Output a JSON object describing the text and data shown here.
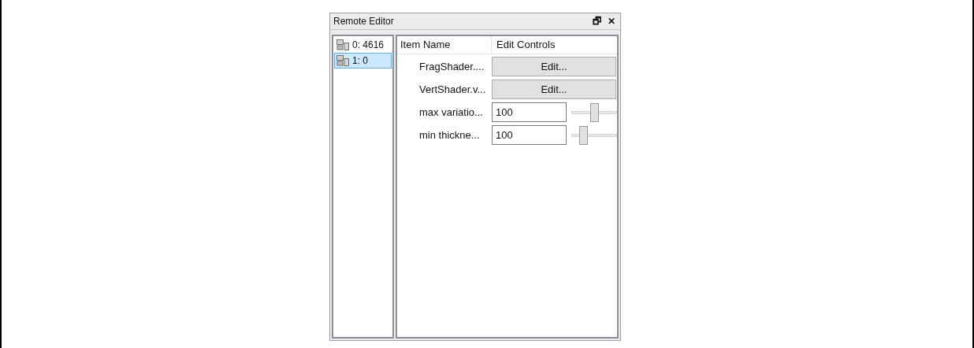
{
  "window": {
    "title": "Remote Editor",
    "buttons": [
      "🗗",
      "✕"
    ]
  },
  "connections": [
    {
      "label": "0: 4616",
      "selected": false
    },
    {
      "label": "1: 0",
      "selected": true
    }
  ],
  "table": {
    "columns": [
      "Item Name",
      "Edit Controls"
    ],
    "rows": [
      {
        "kind": "button",
        "name": "FragShader....",
        "button": "Edit..."
      },
      {
        "kind": "button",
        "name": "VertShader.v...",
        "button": "Edit..."
      },
      {
        "kind": "slider",
        "name": "max variatio...",
        "value": "100",
        "level": 0.5
      },
      {
        "kind": "slider",
        "name": "min thickne...",
        "value": "100",
        "level": 0.2
      }
    ]
  }
}
